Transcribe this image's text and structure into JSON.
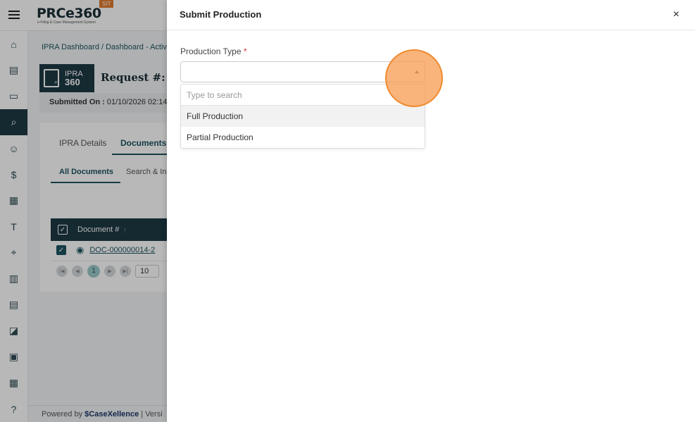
{
  "app": {
    "logo": "PRCe360",
    "logo_sub": "e-Filing & Case Management System",
    "env_badge": "SIT"
  },
  "sidebar": {
    "icons": [
      "bank-icon",
      "document-icon",
      "chat-icon",
      "search-document-icon",
      "people-icon",
      "dollar-document-icon",
      "building-icon",
      "template-icon",
      "scan-icon",
      "book-icon",
      "file-icon",
      "chart-icon",
      "clipboard-icon",
      "calendar-icon",
      "help-icon"
    ]
  },
  "page": {
    "breadcrumb": "IPRA Dashboard / Dashboard - Activ",
    "badge_line1": "IPRA",
    "badge_line2": "360",
    "request_title": "Request #: IPR",
    "submitted_label": "Submitted On :",
    "submitted_value": "01/10/2026 02:14",
    "tabs": [
      "IPRA Details",
      "Documents"
    ],
    "subtabs": [
      "All Documents",
      "Search & In"
    ],
    "table_header": "Document #",
    "sort_glyph": "↑",
    "row_doc": "DOC-000000014-2",
    "page_current": "1",
    "page_size": "10",
    "footer_powered": "Powered by",
    "footer_brand": "CaseXellence",
    "footer_version": "| Versi"
  },
  "drawer": {
    "title": "Submit Production",
    "close_label": "×",
    "field_label": "Production Type",
    "required_mark": "*",
    "select_value": "",
    "search_placeholder": "Type to search",
    "options": [
      "Full Production",
      "Partial Production"
    ]
  },
  "colors": {
    "primary": "#1e3a45",
    "accent": "#1d5460",
    "click_marker": "#f79b50"
  }
}
